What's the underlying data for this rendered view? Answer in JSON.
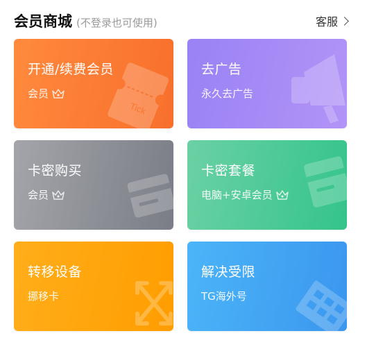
{
  "header": {
    "title": "会员商城",
    "subtitle": "(不登录也可使用)",
    "service_label": "客服"
  },
  "cards": [
    {
      "title": "开通/续费会员",
      "subtitle": "会员",
      "ticket_text": "Tick",
      "icon": "ticket-icon",
      "color": "#f97a32"
    },
    {
      "title": "去广告",
      "subtitle": "永久去广告",
      "icon": "megaphone-icon",
      "color": "#a68af6"
    },
    {
      "title": "卡密购买",
      "subtitle": "会员",
      "icon": "card-icon",
      "color": "#8e9097"
    },
    {
      "title": "卡密套餐",
      "subtitle": "电脑+安卓会员",
      "icon": "card-icon",
      "color": "#4cca95"
    },
    {
      "title": "转移设备",
      "subtitle": "挪移卡",
      "icon": "transfer-arrows-icon",
      "color": "#ffa50d"
    },
    {
      "title": "解决受限",
      "subtitle": "TG海外号",
      "icon": "grid-cube-icon",
      "color": "#44a6f3"
    }
  ]
}
